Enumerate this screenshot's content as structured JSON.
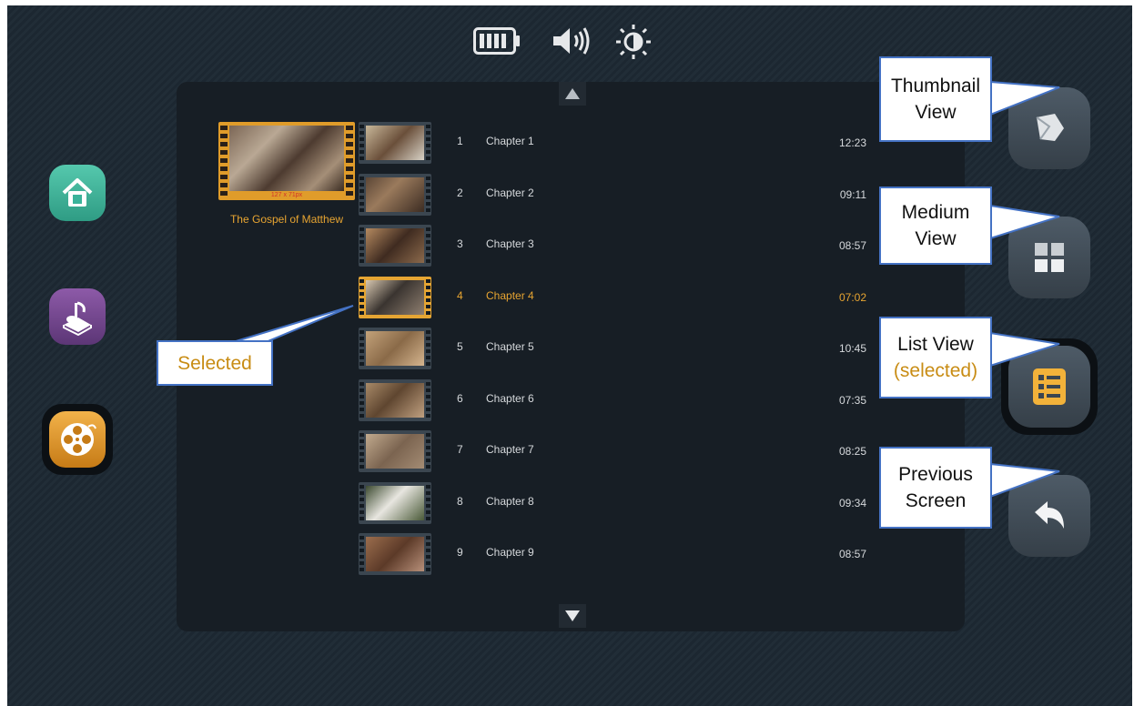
{
  "status_bar": {
    "icons": [
      "battery-icon",
      "speaker-icon",
      "brightness-icon"
    ]
  },
  "side_nav": {
    "icons": [
      "home-icon",
      "music-book-icon",
      "film-reel-icon"
    ],
    "active": "film-reel-icon"
  },
  "cover": {
    "caption": "127 x 71px",
    "title": "The Gospel of Matthew"
  },
  "chapters": [
    {
      "num": "1",
      "title": "Chapter 1",
      "duration": "12:23"
    },
    {
      "num": "2",
      "title": "Chapter 2",
      "duration": "09:11"
    },
    {
      "num": "3",
      "title": "Chapter 3",
      "duration": "08:57"
    },
    {
      "num": "4",
      "title": "Chapter 4",
      "duration": "07:02",
      "selected": true
    },
    {
      "num": "5",
      "title": "Chapter 5",
      "duration": "10:45"
    },
    {
      "num": "6",
      "title": "Chapter 6",
      "duration": "07:35"
    },
    {
      "num": "7",
      "title": "Chapter 7",
      "duration": "08:25"
    },
    {
      "num": "8",
      "title": "Chapter 8",
      "duration": "09:34"
    },
    {
      "num": "9",
      "title": "Chapter 9",
      "duration": "08:57"
    }
  ],
  "right_nav": {
    "icons": [
      "thumbnail-view-icon",
      "medium-view-icon",
      "list-view-icon",
      "back-arrow-icon"
    ],
    "active": "list-view-icon"
  },
  "callouts": {
    "thumbnail_1": "Thumbnail",
    "thumbnail_2": "View",
    "medium_1": "Medium",
    "medium_2": "View",
    "list_1": "List View",
    "list_2": "(selected)",
    "prev_1": "Previous",
    "prev_2": "Screen",
    "selected": "Selected"
  },
  "colors": {
    "accent": "#e8a531",
    "callout_border": "#4472c4",
    "panel": "#171e25",
    "background": "#1c2731"
  }
}
